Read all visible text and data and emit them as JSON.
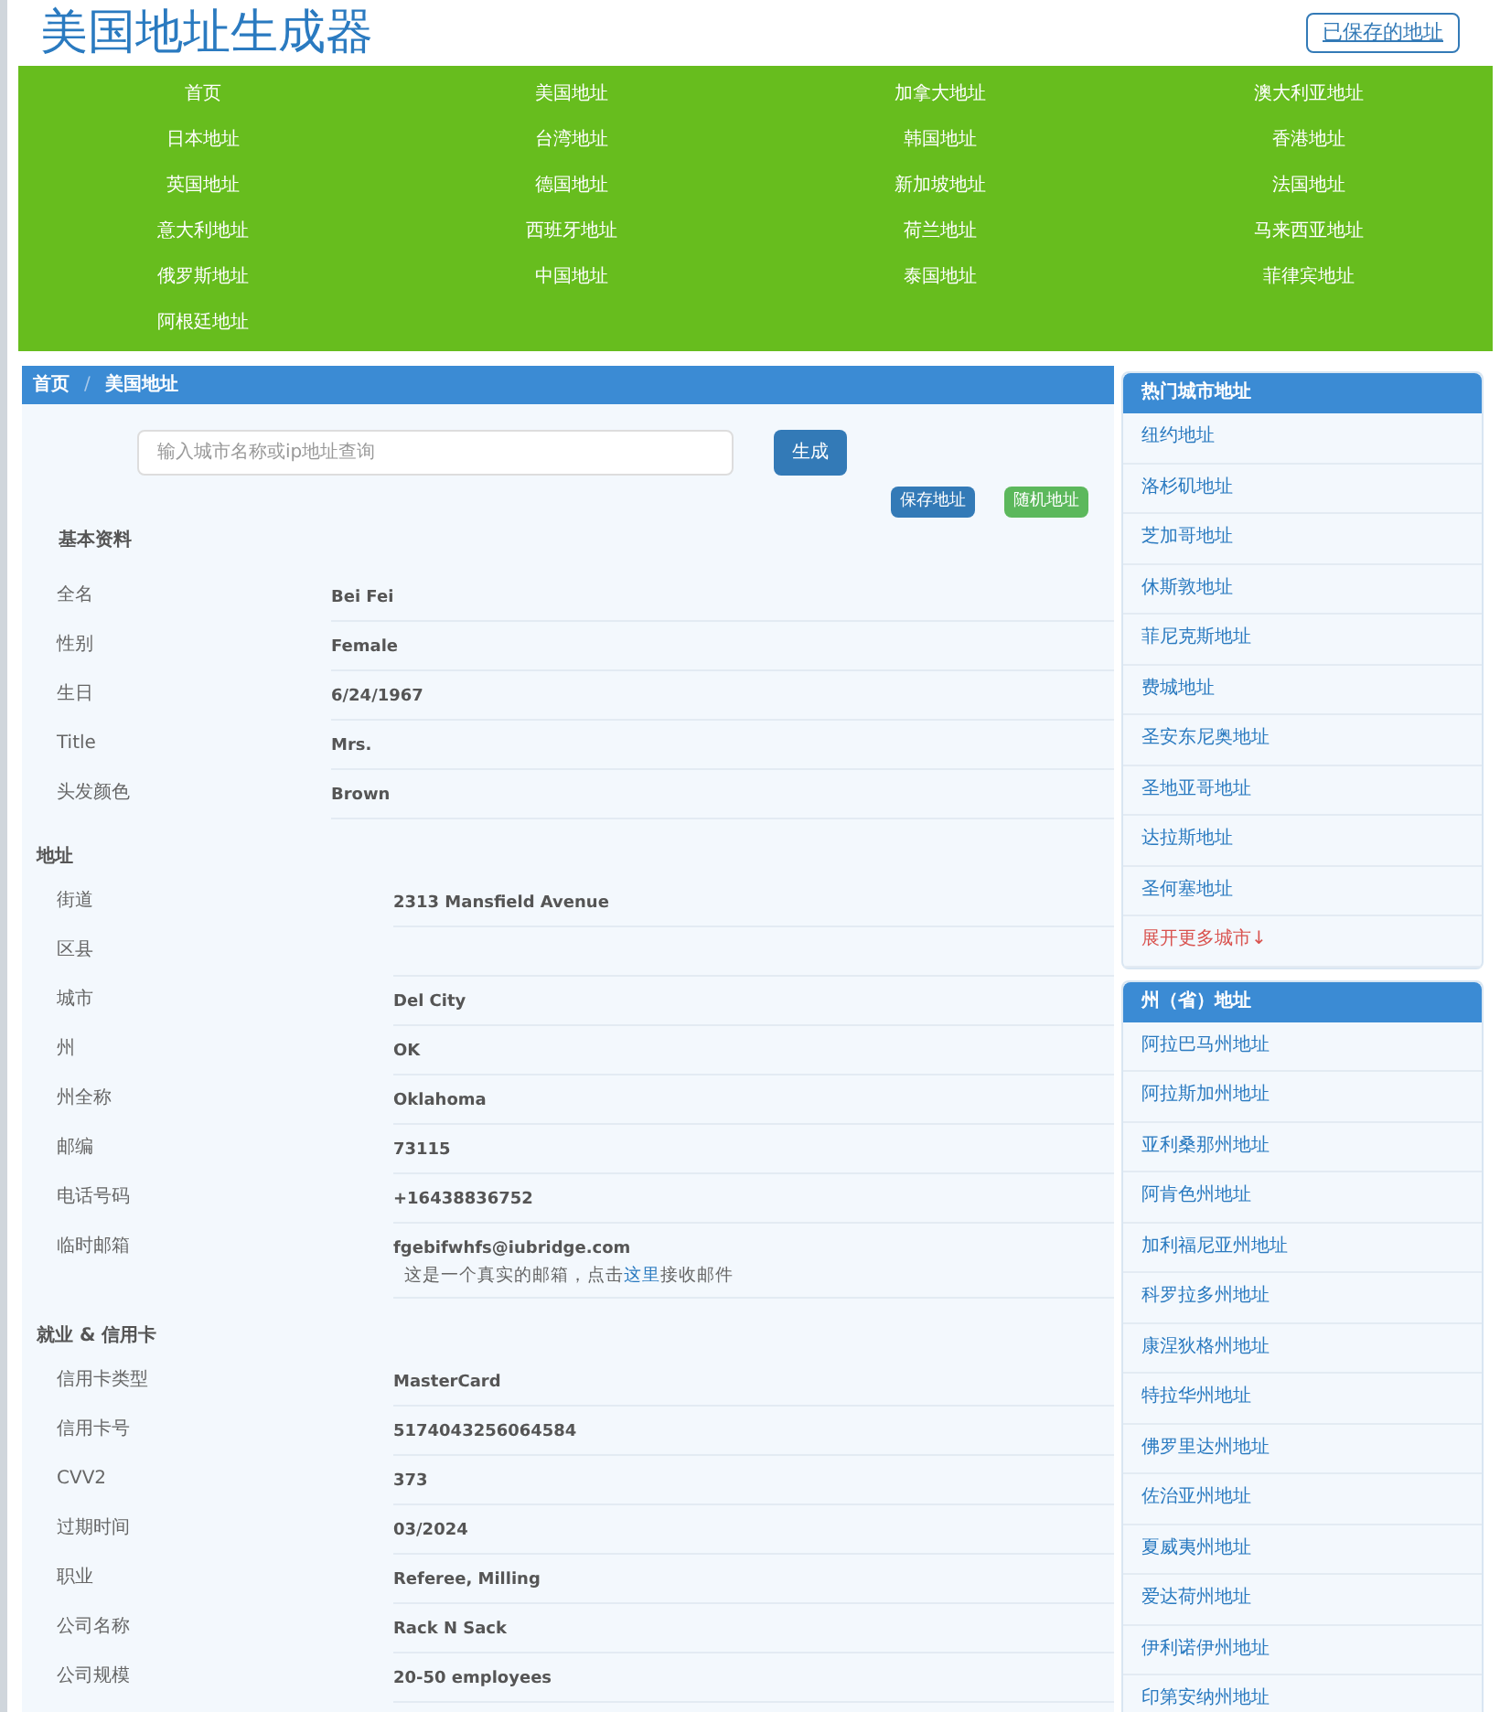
{
  "header": {
    "title": "美国地址生成器",
    "saved_button": "已保存的地址"
  },
  "nav": [
    "首页",
    "美国地址",
    "加拿大地址",
    "澳大利亚地址",
    "日本地址",
    "台湾地址",
    "韩国地址",
    "香港地址",
    "英国地址",
    "德国地址",
    "新加坡地址",
    "法国地址",
    "意大利地址",
    "西班牙地址",
    "荷兰地址",
    "马来西亚地址",
    "俄罗斯地址",
    "中国地址",
    "泰国地址",
    "菲律宾地址",
    "阿根廷地址"
  ],
  "breadcrumb": [
    "首页",
    "美国地址"
  ],
  "breadcrumb_separator": "/",
  "search": {
    "placeholder": "输入城市名称或ip地址查询",
    "button": "生成"
  },
  "actions": [
    {
      "label": "保存地址",
      "kind": "primary"
    },
    {
      "label": "随机地址",
      "kind": "success"
    }
  ],
  "sections": [
    {
      "title": "基本资料",
      "rows": [
        {
          "label": "全名",
          "value": "Bei Fei"
        },
        {
          "label": "性别",
          "value": "Female"
        },
        {
          "label": "生日",
          "value": "6/24/1967"
        },
        {
          "label": "Title",
          "value": "Mrs."
        },
        {
          "label": "头发颜色",
          "value": "Brown"
        }
      ]
    },
    {
      "title": "地址",
      "rows": [
        {
          "label": "街道",
          "value": "2313 Mansfield Avenue"
        },
        {
          "label": "区县"
        },
        {
          "label": "城市",
          "value": "Del City"
        },
        {
          "label": "州",
          "value": "OK"
        },
        {
          "label": "州全称",
          "value": "Oklahoma"
        },
        {
          "label": "邮编",
          "value": "73115"
        },
        {
          "label": "电话号码",
          "value": "+16438836752"
        },
        {
          "label": "临时邮箱",
          "value": "fgebifwhfs@iubridge.com",
          "note": {
            "before": "这是一个真实的邮箱，点击",
            "link": "这里",
            "after": "接收邮件"
          }
        }
      ]
    },
    {
      "title": "就业 & 信用卡",
      "rows": [
        {
          "label": "信用卡类型",
          "value": "MasterCard"
        },
        {
          "label": "信用卡号",
          "value": "5174043256064584"
        },
        {
          "label": "CVV2",
          "value": "373"
        },
        {
          "label": "过期时间",
          "value": "03/2024"
        },
        {
          "label": "职业",
          "value": "Referee, Milling"
        },
        {
          "label": "公司名称",
          "value": "Rack N Sack"
        },
        {
          "label": "公司规模",
          "value": "20-50 employees"
        }
      ]
    }
  ],
  "sidebar": [
    {
      "title": "热门城市地址",
      "items": [
        {
          "label": "纽约地址",
          "kind": "link"
        },
        {
          "label": "洛杉矶地址",
          "kind": "link"
        },
        {
          "label": "芝加哥地址",
          "kind": "link"
        },
        {
          "label": "休斯敦地址",
          "kind": "link"
        },
        {
          "label": "菲尼克斯地址",
          "kind": "link"
        },
        {
          "label": "费城地址",
          "kind": "link"
        },
        {
          "label": "圣安东尼奥地址",
          "kind": "link"
        },
        {
          "label": "圣地亚哥地址",
          "kind": "link"
        },
        {
          "label": "达拉斯地址",
          "kind": "link"
        },
        {
          "label": "圣何塞地址",
          "kind": "link"
        },
        {
          "label": "展开更多城市↓",
          "kind": "more"
        }
      ]
    },
    {
      "title": "州（省）地址",
      "items": [
        {
          "label": "阿拉巴马州地址",
          "kind": "link"
        },
        {
          "label": "阿拉斯加州地址",
          "kind": "link"
        },
        {
          "label": "亚利桑那州地址",
          "kind": "link"
        },
        {
          "label": "阿肯色州地址",
          "kind": "link"
        },
        {
          "label": "加利福尼亚州地址",
          "kind": "link"
        },
        {
          "label": "科罗拉多州地址",
          "kind": "link"
        },
        {
          "label": "康涅狄格州地址",
          "kind": "link"
        },
        {
          "label": "特拉华州地址",
          "kind": "link"
        },
        {
          "label": "佛罗里达州地址",
          "kind": "link"
        },
        {
          "label": "佐治亚州地址",
          "kind": "link"
        },
        {
          "label": "夏威夷州地址",
          "kind": "link"
        },
        {
          "label": "爱达荷州地址",
          "kind": "link"
        },
        {
          "label": "伊利诺伊州地址",
          "kind": "link"
        },
        {
          "label": "印第安纳州地址",
          "kind": "link"
        }
      ]
    }
  ]
}
